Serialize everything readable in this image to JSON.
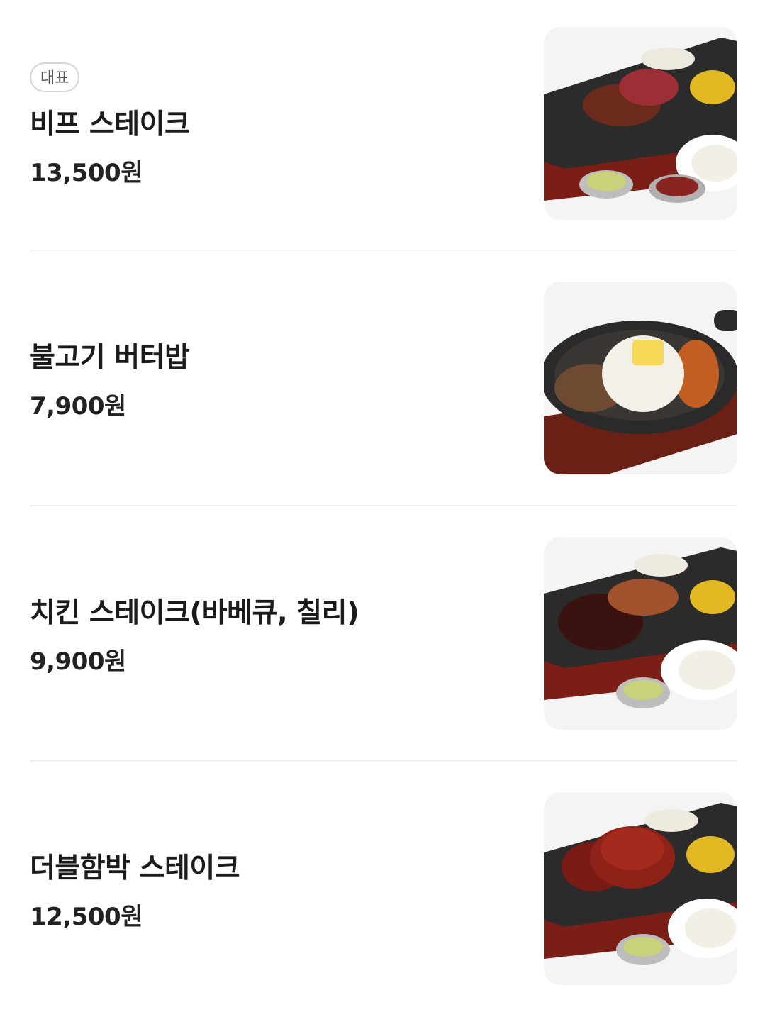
{
  "items": [
    {
      "badge": "대표",
      "name": "비프 스테이크",
      "price": "13,500원",
      "image_icon": "beef-steak-plate"
    },
    {
      "name": "불고기 버터밥",
      "price": "7,900원",
      "image_icon": "bulgogi-butter-rice-skillet"
    },
    {
      "name": "치킨 스테이크(바베큐, 칠리)",
      "price": "9,900원",
      "image_icon": "chicken-steak-plate"
    },
    {
      "name": "더블함박 스테이크",
      "price": "12,500원",
      "image_icon": "double-hamburg-steak-plate"
    }
  ]
}
